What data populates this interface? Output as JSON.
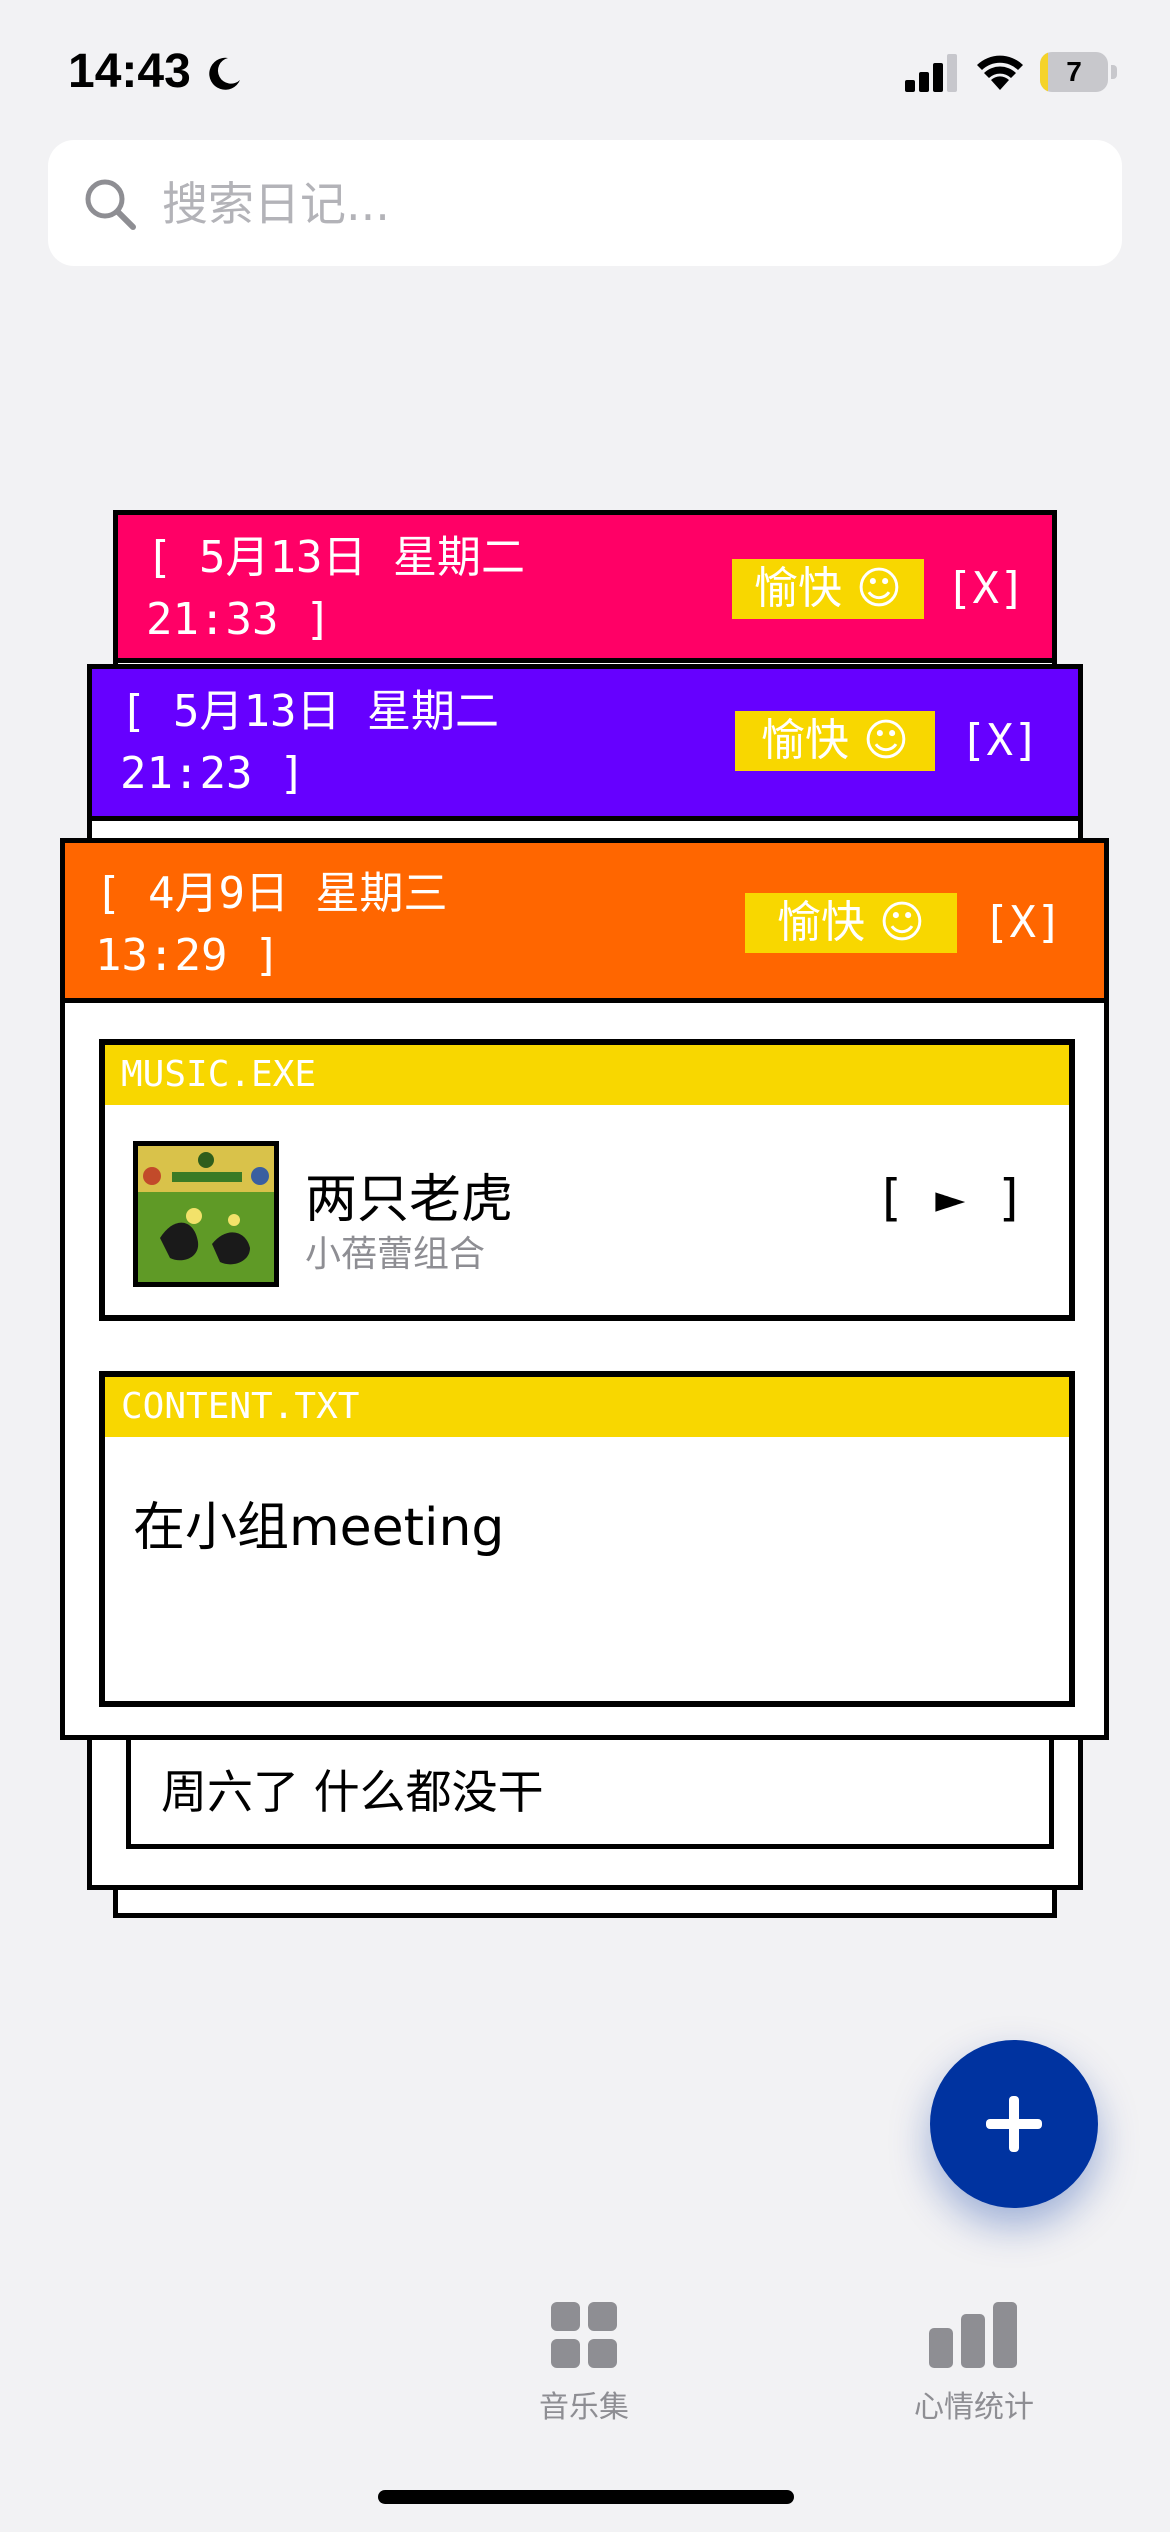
{
  "status_bar": {
    "time": "14:43",
    "battery_level": "7",
    "battery_fraction": 0.07
  },
  "search": {
    "placeholder": "搜索日记..."
  },
  "entries": [
    {
      "date": "[ 5月13日 星期二\n21:33 ]",
      "mood": "愉快 ☺",
      "close": "[X]",
      "color": "#ff0066",
      "preview": ""
    },
    {
      "date": "[ 5月13日 星期二\n21:23 ]",
      "mood": "愉快 ☺",
      "close": "[X]",
      "color": "#6600ff",
      "preview": "周六了 什么都没干"
    },
    {
      "date": "[ 4月9日 星期三\n13:29 ]",
      "mood": "愉快 ☺",
      "close": "[X]",
      "color": "#ff6600",
      "music": {
        "header": "MUSIC.EXE",
        "title": "两只老虎",
        "artist": "小蓓蕾组合",
        "play": "[ ► ]"
      },
      "content": {
        "header": "CONTENT.TXT",
        "text": "在小组meeting"
      }
    }
  ],
  "colors": {
    "badge": "#f8d700",
    "fab": "#0033a0",
    "background": "#f2f2f4"
  },
  "fab": {
    "icon": "plus-icon"
  },
  "bottom_nav": [
    {
      "label": "音乐集",
      "icon": "grid-icon"
    },
    {
      "label": "心情统计",
      "icon": "bar-chart-icon"
    }
  ]
}
